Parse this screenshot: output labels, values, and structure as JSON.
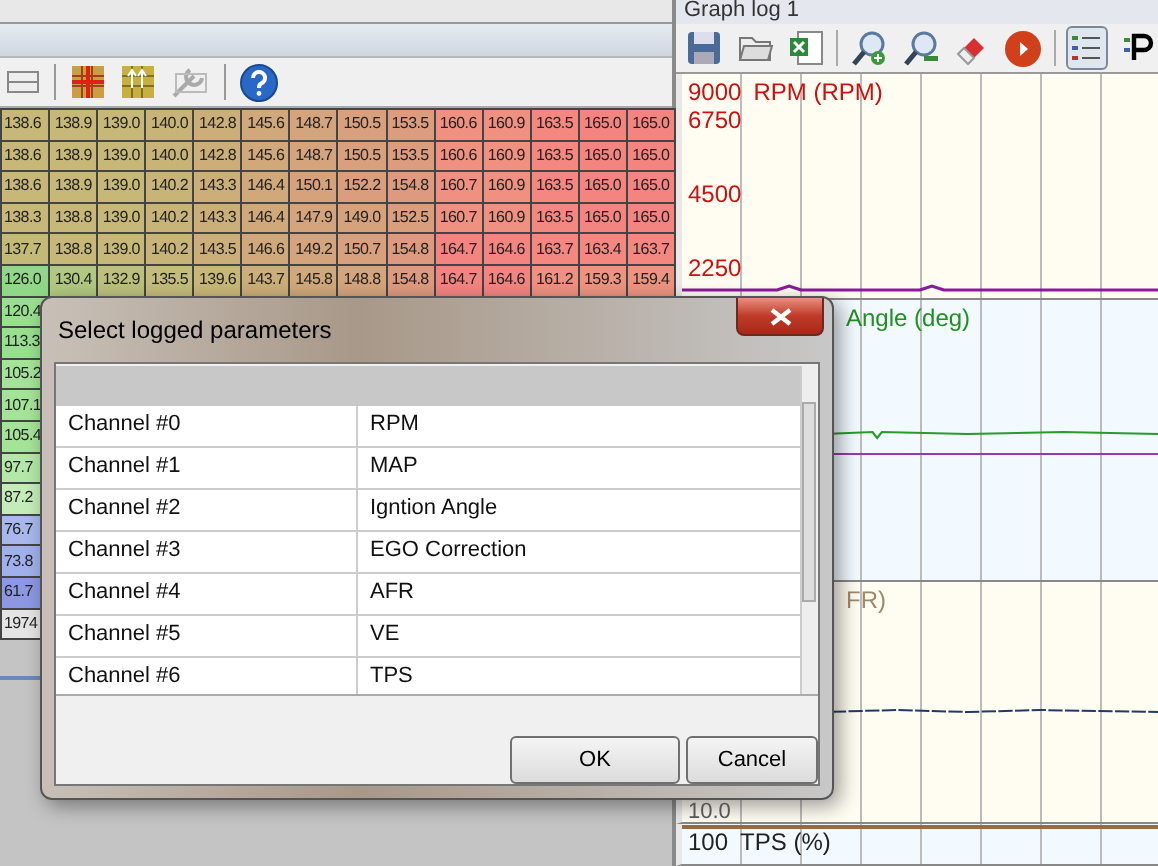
{
  "table": {
    "rows": [
      {
        "cells": [
          {
            "text": "138.6",
            "color": "#c8b878"
          },
          {
            "text": "138.9",
            "color": "#c8b878"
          },
          {
            "text": "139.0",
            "color": "#c8b878"
          },
          {
            "text": "140.0",
            "color": "#c9b478"
          },
          {
            "text": "142.8",
            "color": "#ccae78"
          },
          {
            "text": "145.6",
            "color": "#d0a87a"
          },
          {
            "text": "148.7",
            "color": "#d4a47c"
          },
          {
            "text": "150.5",
            "color": "#d8a07c"
          },
          {
            "text": "153.5",
            "color": "#dc9c7e"
          },
          {
            "text": "160.6",
            "color": "#f09080"
          },
          {
            "text": "160.9",
            "color": "#f09080"
          },
          {
            "text": "163.5",
            "color": "#f48880"
          },
          {
            "text": "165.0",
            "color": "#f48480"
          },
          {
            "text": "165.0",
            "color": "#f48480"
          }
        ]
      },
      {
        "cells": [
          {
            "text": "138.6",
            "color": "#c8b878"
          },
          {
            "text": "138.9",
            "color": "#c8b878"
          },
          {
            "text": "139.0",
            "color": "#c8b878"
          },
          {
            "text": "140.0",
            "color": "#c9b478"
          },
          {
            "text": "142.8",
            "color": "#ccae78"
          },
          {
            "text": "145.6",
            "color": "#d0a87a"
          },
          {
            "text": "148.7",
            "color": "#d4a47c"
          },
          {
            "text": "150.5",
            "color": "#d8a07c"
          },
          {
            "text": "153.5",
            "color": "#dc9c7e"
          },
          {
            "text": "160.6",
            "color": "#f09080"
          },
          {
            "text": "160.9",
            "color": "#f09080"
          },
          {
            "text": "163.5",
            "color": "#f48880"
          },
          {
            "text": "165.0",
            "color": "#f48480"
          },
          {
            "text": "165.0",
            "color": "#f48480"
          }
        ]
      },
      {
        "cells": [
          {
            "text": "138.6",
            "color": "#c8b878"
          },
          {
            "text": "138.9",
            "color": "#c8b878"
          },
          {
            "text": "139.0",
            "color": "#c8b878"
          },
          {
            "text": "140.2",
            "color": "#c9b478"
          },
          {
            "text": "143.3",
            "color": "#ccae78"
          },
          {
            "text": "146.4",
            "color": "#d0a87a"
          },
          {
            "text": "150.1",
            "color": "#d6a27c"
          },
          {
            "text": "152.2",
            "color": "#da9e7c"
          },
          {
            "text": "154.8",
            "color": "#de9a7e"
          },
          {
            "text": "160.7",
            "color": "#f09080"
          },
          {
            "text": "160.9",
            "color": "#f09080"
          },
          {
            "text": "163.5",
            "color": "#f48880"
          },
          {
            "text": "165.0",
            "color": "#f48480"
          },
          {
            "text": "165.0",
            "color": "#f48480"
          }
        ]
      },
      {
        "cells": [
          {
            "text": "138.3",
            "color": "#c8b878"
          },
          {
            "text": "138.8",
            "color": "#c8b878"
          },
          {
            "text": "139.0",
            "color": "#c8b878"
          },
          {
            "text": "140.2",
            "color": "#c9b478"
          },
          {
            "text": "143.3",
            "color": "#ccae78"
          },
          {
            "text": "146.4",
            "color": "#d0a87a"
          },
          {
            "text": "147.9",
            "color": "#d4a47c"
          },
          {
            "text": "149.0",
            "color": "#d6a27c"
          },
          {
            "text": "152.5",
            "color": "#da9e7c"
          },
          {
            "text": "160.7",
            "color": "#f09080"
          },
          {
            "text": "160.9",
            "color": "#f09080"
          },
          {
            "text": "163.5",
            "color": "#f48880"
          },
          {
            "text": "165.0",
            "color": "#f48480"
          },
          {
            "text": "165.0",
            "color": "#f48480"
          }
        ]
      },
      {
        "cells": [
          {
            "text": "137.7",
            "color": "#c4ba78"
          },
          {
            "text": "138.8",
            "color": "#c8b878"
          },
          {
            "text": "139.0",
            "color": "#c8b878"
          },
          {
            "text": "140.2",
            "color": "#c9b478"
          },
          {
            "text": "143.5",
            "color": "#ccae78"
          },
          {
            "text": "146.6",
            "color": "#d0a87a"
          },
          {
            "text": "149.2",
            "color": "#d4a47c"
          },
          {
            "text": "150.7",
            "color": "#d8a07c"
          },
          {
            "text": "154.8",
            "color": "#de9a7e"
          },
          {
            "text": "164.7",
            "color": "#f48480"
          },
          {
            "text": "164.6",
            "color": "#f48480"
          },
          {
            "text": "163.7",
            "color": "#f48880"
          },
          {
            "text": "163.4",
            "color": "#f48880"
          },
          {
            "text": "163.7",
            "color": "#f48880"
          }
        ]
      },
      {
        "cells": [
          {
            "text": "126.0",
            "color": "#90d888"
          },
          {
            "text": "130.4",
            "color": "#b0c880"
          },
          {
            "text": "132.9",
            "color": "#bcc07c"
          },
          {
            "text": "135.5",
            "color": "#c4bc7a"
          },
          {
            "text": "139.6",
            "color": "#c8b878"
          },
          {
            "text": "143.7",
            "color": "#ccae78"
          },
          {
            "text": "145.8",
            "color": "#d0a87a"
          },
          {
            "text": "148.8",
            "color": "#d4a47c"
          },
          {
            "text": "154.8",
            "color": "#de9a7e"
          },
          {
            "text": "164.7",
            "color": "#f48480"
          },
          {
            "text": "164.6",
            "color": "#f48480"
          },
          {
            "text": "161.2",
            "color": "#f09080"
          },
          {
            "text": "159.3",
            "color": "#ec9480"
          },
          {
            "text": "159.4",
            "color": "#ec9480"
          }
        ]
      },
      {
        "cells": [
          {
            "text": "120.4",
            "color": "#98e090"
          }
        ]
      },
      {
        "cells": [
          {
            "text": "113.3",
            "color": "#98e090"
          }
        ]
      },
      {
        "cells": [
          {
            "text": "105.2",
            "color": "#a4e498"
          }
        ]
      },
      {
        "cells": [
          {
            "text": "107.1",
            "color": "#a4e498"
          }
        ]
      },
      {
        "cells": [
          {
            "text": "105.4",
            "color": "#a4e498"
          }
        ]
      },
      {
        "cells": [
          {
            "text": "97.7",
            "color": "#b4e8a8"
          }
        ]
      },
      {
        "cells": [
          {
            "text": "87.2",
            "color": "#c4ecb8"
          }
        ]
      },
      {
        "cells": [
          {
            "text": "76.7",
            "color": "#a8b8ec"
          }
        ]
      },
      {
        "cells": [
          {
            "text": "73.8",
            "color": "#a0b0ec"
          }
        ]
      },
      {
        "cells": [
          {
            "text": "61.7",
            "color": "#8c98e4"
          }
        ]
      },
      {
        "cells": [
          {
            "text": "1974",
            "color": "#e4e4e4"
          }
        ]
      }
    ]
  },
  "graph": {
    "title": "Graph log 1",
    "legend_pressed": true,
    "panels": [
      {
        "label": "RPM (RPM)",
        "color": "#cc1010",
        "ticks": [
          "9000",
          "6750",
          "4500",
          "2250"
        ]
      },
      {
        "label": "Angle (deg)",
        "color": "#209020"
      },
      {
        "label": "FR)",
        "color": "#a08868",
        "bottom_tick": "10.0"
      },
      {
        "label": "TPS (%)",
        "color": "#222222",
        "ticks": [
          "100"
        ]
      }
    ]
  },
  "dialog": {
    "title": "Select logged parameters",
    "rows": [
      {
        "channel": "Channel #0",
        "name": "RPM"
      },
      {
        "channel": "Channel #1",
        "name": "MAP"
      },
      {
        "channel": "Channel #2",
        "name": "Igntion Angle"
      },
      {
        "channel": "Channel #3",
        "name": "EGO Correction"
      },
      {
        "channel": "Channel #4",
        "name": "AFR"
      },
      {
        "channel": "Channel #5",
        "name": "VE"
      },
      {
        "channel": "Channel #6",
        "name": "TPS"
      }
    ],
    "buttons": [
      "OK",
      "Cancel"
    ]
  }
}
